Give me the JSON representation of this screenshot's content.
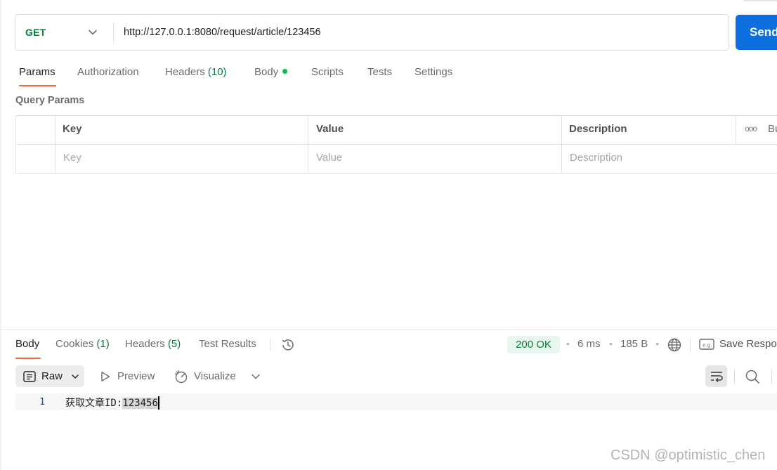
{
  "request": {
    "method": "GET",
    "url": "http://127.0.0.1:8080/request/article/123456",
    "send_label": "Send"
  },
  "request_tabs": {
    "params": "Params",
    "authorization": "Authorization",
    "headers": "Headers",
    "headers_count": "(10)",
    "body": "Body",
    "scripts": "Scripts",
    "tests": "Tests",
    "settings": "Settings"
  },
  "query_params": {
    "title": "Query Params",
    "columns": {
      "key": "Key",
      "value": "Value",
      "description": "Description",
      "bulk": "Bu"
    },
    "placeholders": {
      "key": "Key",
      "value": "Value",
      "description": "Description"
    }
  },
  "response_tabs": {
    "body": "Body",
    "cookies": "Cookies",
    "cookies_count": "(1)",
    "headers": "Headers",
    "headers_count": "(5)",
    "test_results": "Test Results"
  },
  "response_meta": {
    "status": "200 OK",
    "time": "6 ms",
    "size": "185 B",
    "separator": "•",
    "save_label": "Save Respo"
  },
  "response_toolbar": {
    "raw": "Raw",
    "preview": "Preview",
    "visualize": "Visualize"
  },
  "response_body": {
    "line_number": "1",
    "text_prefix": "获取文章ID:",
    "text_selected": "123456"
  },
  "watermark": "CSDN @optimistic_chen",
  "colors": {
    "accent": "#f26b3a",
    "send": "#0d6fde",
    "method_get": "#0b7a3b",
    "status_bg": "#e7f7ed"
  },
  "icons": [
    "chevron-down-icon",
    "history-icon",
    "globe-icon",
    "save-example-icon",
    "raw-format-icon",
    "play-icon",
    "visualize-icon",
    "wrap-icon",
    "search-icon"
  ]
}
